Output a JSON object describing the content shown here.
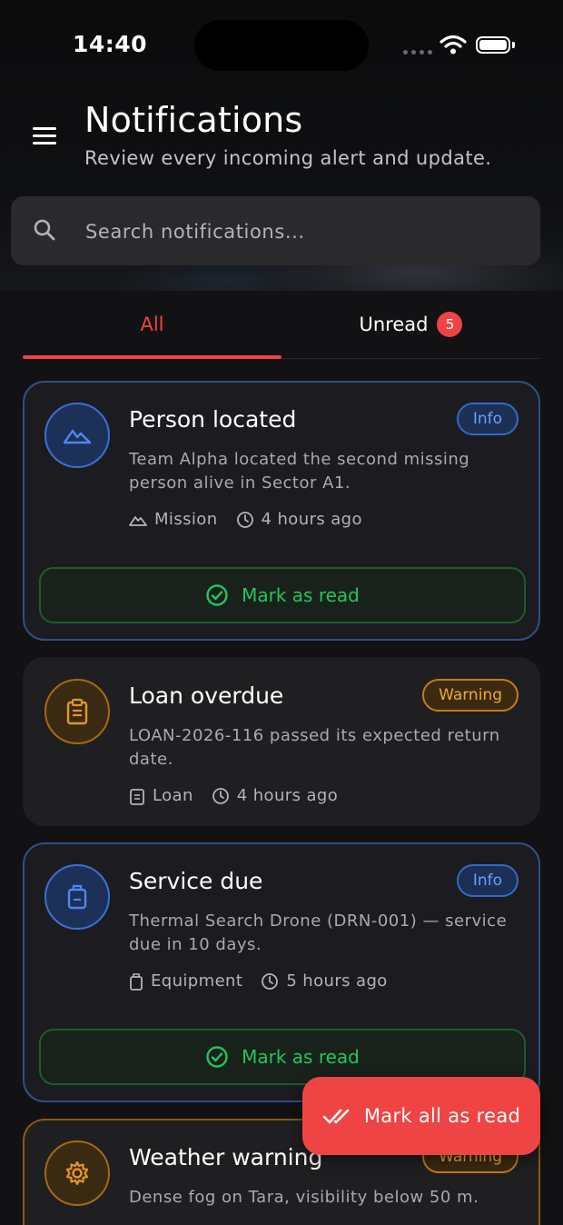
{
  "status_bar": {
    "time": "14:40"
  },
  "header": {
    "title": "Notifications",
    "subtitle": "Review every incoming alert and update."
  },
  "search": {
    "placeholder": "Search notifications..."
  },
  "tabs": {
    "all_label": "All",
    "unread_label": "Unread",
    "unread_count": "5"
  },
  "notifications": [
    {
      "title": "Person located",
      "badge": "Info",
      "description": "Team Alpha located the second missing person alive in Sector A1.",
      "category": "Mission",
      "time": "4 hours ago",
      "action": "Mark as read",
      "icon": "mountain-icon"
    },
    {
      "title": "Loan overdue",
      "badge": "Warning",
      "description": "LOAN-2026-116 passed its expected return date.",
      "category": "Loan",
      "time": "4 hours ago",
      "icon": "clipboard-icon"
    },
    {
      "title": "Service due",
      "badge": "Info",
      "description": "Thermal Search Drone (DRN-001) — service due in 10 days.",
      "category": "Equipment",
      "time": "5 hours ago",
      "action": "Mark as read",
      "icon": "backpack-icon"
    },
    {
      "title": "Weather warning",
      "badge": "Warning",
      "description": "Dense fog on Tara, visibility below 50 m.",
      "icon": "gear-icon"
    }
  ],
  "fab": {
    "label": "Mark all as read"
  },
  "colors": {
    "accent_red": "#ef4444",
    "info_blue": "#3b6fd6",
    "warning_amber": "#f0a83a",
    "success_green": "#22c55e",
    "background": "#121214",
    "card": "#1f1f22"
  }
}
